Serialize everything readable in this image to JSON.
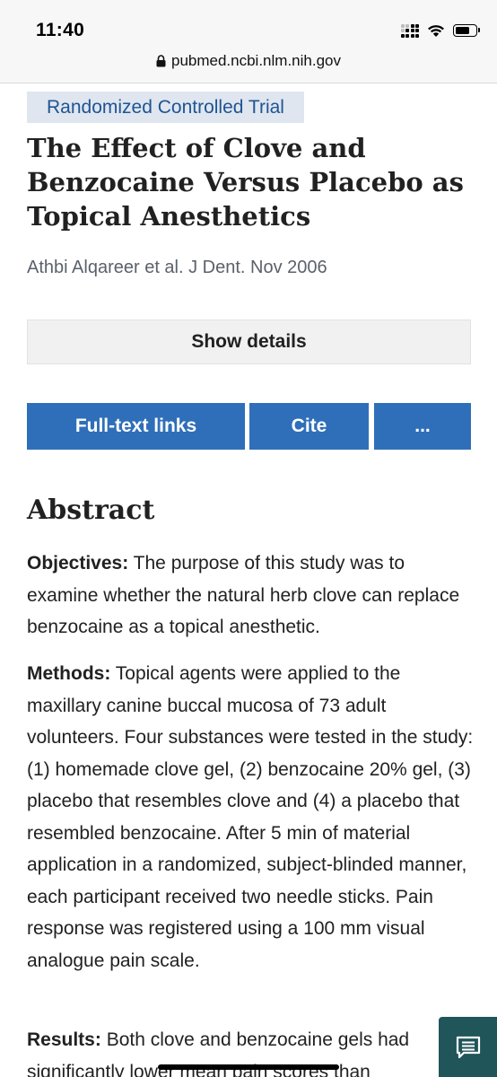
{
  "status_bar": {
    "time": "11:40"
  },
  "browser": {
    "url": "pubmed.ncbi.nlm.nih.gov"
  },
  "article": {
    "type_badge": "Randomized Controlled Trial",
    "title": "The Effect of Clove and Benzocaine Versus Placebo as Topical Anesthetics",
    "citation": "Athbi Alqareer et al. J Dent. Nov 2006"
  },
  "buttons": {
    "show_details": "Show details",
    "full_text_links": "Full-text links",
    "cite": "Cite",
    "more": "..."
  },
  "abstract": {
    "heading": "Abstract",
    "sections": [
      {
        "label": "Objectives:",
        "text": " The purpose of this study was to examine whether the natural herb clove can replace benzocaine as a topical anesthetic."
      },
      {
        "label": "Methods:",
        "text": " Topical agents were applied to the maxillary canine buccal mucosa of 73 adult volunteers. Four substances were tested in the study: (1) homemade clove gel, (2) benzocaine 20% gel, (3) placebo that resembles clove and (4) a placebo that resembled benzocaine. After 5 min of material application in a randomized, subject-blinded manner, each participant received two needle sticks. Pain response was registered using a 100 mm visual analogue pain scale."
      },
      {
        "label": "Results:",
        "text": " Both clove and benzocaine gels had significantly lower mean pain scores than"
      }
    ]
  },
  "icons": {
    "lock": "lock-icon",
    "wifi": "wifi-icon",
    "battery": "battery-icon",
    "signal": "signal-icon",
    "feedback": "feedback-icon"
  },
  "colors": {
    "accent": "#2f6fb9",
    "badge_bg": "#dfe6ef",
    "badge_text": "#205493",
    "feedback_bg": "#20555a"
  }
}
